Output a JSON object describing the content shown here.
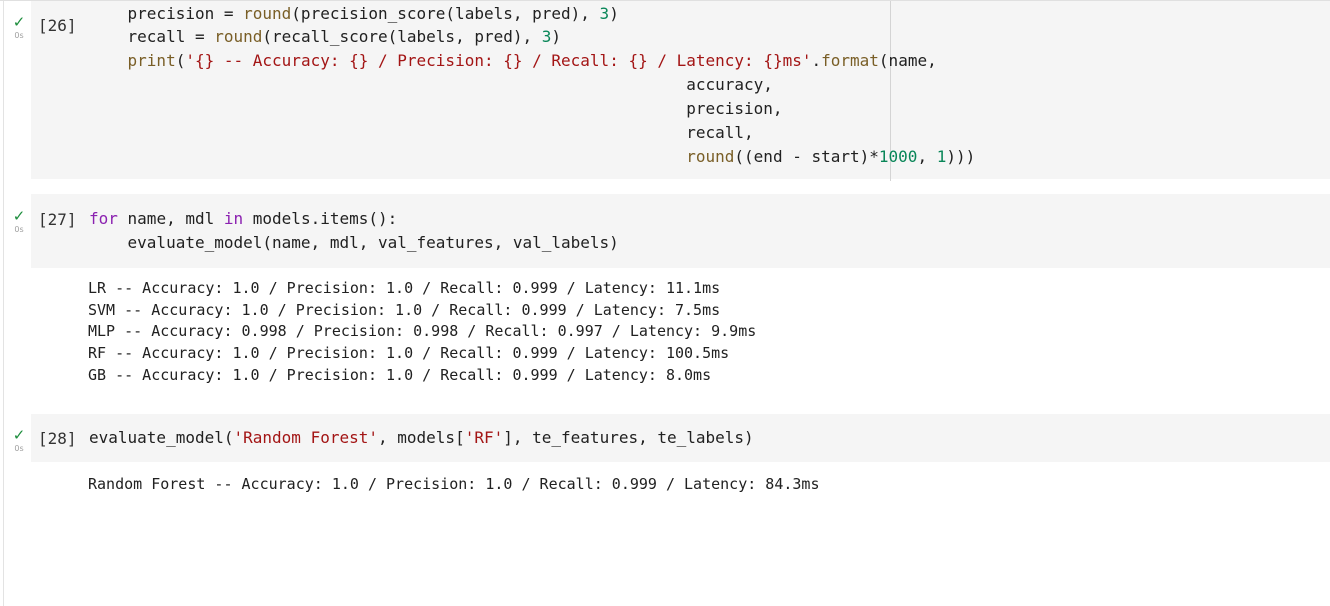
{
  "cells": [
    {
      "count": "[26]",
      "status_time": "0s",
      "lines": [
        {
          "indent": "    ",
          "segments": [
            {
              "t": "precision = ",
              "c": "plain"
            },
            {
              "t": "round",
              "c": "fn"
            },
            {
              "t": "(precision_score(labels, pred), ",
              "c": "plain"
            },
            {
              "t": "3",
              "c": "num"
            },
            {
              "t": ")",
              "c": "plain"
            }
          ]
        },
        {
          "indent": "    ",
          "segments": [
            {
              "t": "recall = ",
              "c": "plain"
            },
            {
              "t": "round",
              "c": "fn"
            },
            {
              "t": "(recall_score(labels, pred), ",
              "c": "plain"
            },
            {
              "t": "3",
              "c": "num"
            },
            {
              "t": ")",
              "c": "plain"
            }
          ]
        },
        {
          "indent": "    ",
          "segments": [
            {
              "t": "print",
              "c": "fn"
            },
            {
              "t": "(",
              "c": "plain"
            },
            {
              "t": "'{} -- Accuracy: {} / Precision: {} / Recall: {} / Latency: {}ms'",
              "c": "str"
            },
            {
              "t": ".",
              "c": "plain"
            },
            {
              "t": "format",
              "c": "fn"
            },
            {
              "t": "(name,",
              "c": "plain"
            }
          ]
        },
        {
          "indent": "                                                              ",
          "segments": [
            {
              "t": "accuracy,",
              "c": "plain"
            }
          ]
        },
        {
          "indent": "                                                              ",
          "segments": [
            {
              "t": "precision,",
              "c": "plain"
            }
          ]
        },
        {
          "indent": "                                                              ",
          "segments": [
            {
              "t": "recall,",
              "c": "plain"
            }
          ]
        },
        {
          "indent": "                                                              ",
          "segments": [
            {
              "t": "round",
              "c": "fn"
            },
            {
              "t": "((end - start)*",
              "c": "plain"
            },
            {
              "t": "1000",
              "c": "num"
            },
            {
              "t": ", ",
              "c": "plain"
            },
            {
              "t": "1",
              "c": "num"
            },
            {
              "t": ")))",
              "c": "plain"
            }
          ]
        }
      ],
      "outputs": []
    },
    {
      "count": "[27]",
      "status_time": "0s",
      "lines": [
        {
          "indent": "",
          "segments": [
            {
              "t": "for",
              "c": "kw"
            },
            {
              "t": " name, mdl ",
              "c": "plain"
            },
            {
              "t": "in",
              "c": "kw"
            },
            {
              "t": " models.items():",
              "c": "plain"
            }
          ]
        },
        {
          "indent": "    ",
          "segments": [
            {
              "t": "evaluate_model(name, mdl, val_features, val_labels)",
              "c": "plain"
            }
          ]
        }
      ],
      "outputs": [
        "LR -- Accuracy: 1.0 / Precision: 1.0 / Recall: 0.999 / Latency: 11.1ms",
        "SVM -- Accuracy: 1.0 / Precision: 1.0 / Recall: 0.999 / Latency: 7.5ms",
        "MLP -- Accuracy: 0.998 / Precision: 0.998 / Recall: 0.997 / Latency: 9.9ms",
        "RF -- Accuracy: 1.0 / Precision: 1.0 / Recall: 0.999 / Latency: 100.5ms",
        "GB -- Accuracy: 1.0 / Precision: 1.0 / Recall: 0.999 / Latency: 8.0ms"
      ]
    },
    {
      "count": "[28]",
      "status_time": "0s",
      "lines": [
        {
          "indent": "",
          "segments": [
            {
              "t": "evaluate_model(",
              "c": "plain"
            },
            {
              "t": "'Random Forest'",
              "c": "str"
            },
            {
              "t": ", models[",
              "c": "plain"
            },
            {
              "t": "'RF'",
              "c": "str"
            },
            {
              "t": "], te_features, te_labels)",
              "c": "plain"
            }
          ]
        }
      ],
      "outputs": [
        "Random Forest -- Accuracy: 1.0 / Precision: 1.0 / Recall: 0.999 / Latency: 84.3ms"
      ]
    }
  ],
  "icons": {
    "status": "checkmark-icon"
  },
  "colors": {
    "status_ok": "#1e8e3e",
    "keyword": "#8b21b0",
    "function": "#795e26",
    "string": "#a31515",
    "number": "#098658",
    "code_bg": "#f5f5f5"
  }
}
